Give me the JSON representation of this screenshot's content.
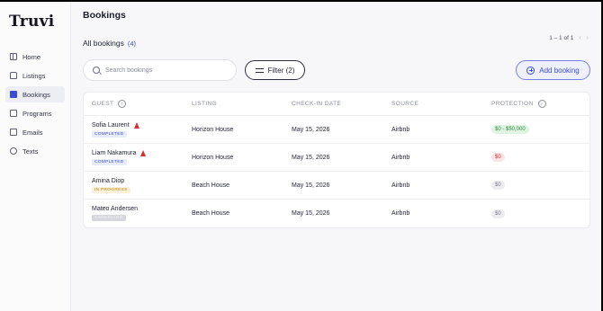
{
  "app": {
    "logo": "Truvi"
  },
  "sidebar": {
    "items": [
      {
        "label": "Home",
        "icon": "home-icon",
        "active": false
      },
      {
        "label": "Listings",
        "icon": "listings-icon",
        "active": false
      },
      {
        "label": "Bookings",
        "icon": "calendar-icon",
        "active": true
      },
      {
        "label": "Programs",
        "icon": "programs-icon",
        "active": false
      },
      {
        "label": "Emails",
        "icon": "mail-icon",
        "active": false
      },
      {
        "label": "Texts",
        "icon": "chat-icon",
        "active": false
      }
    ]
  },
  "header": {
    "title": "Bookings"
  },
  "subheader": {
    "label": "All bookings",
    "count": "(4)"
  },
  "pagination": {
    "range": "1 – 1 of 1",
    "prev": "‹",
    "next": "›"
  },
  "search": {
    "placeholder": "Search bookings",
    "value": ""
  },
  "filter": {
    "label": "Filter (2)"
  },
  "add_booking": {
    "label": "Add booking"
  },
  "table": {
    "columns": [
      "GUEST",
      "LISTING",
      "CHECK-IN DATE",
      "SOURCE",
      "PROTECTION"
    ],
    "info_glyph": "i",
    "rows": [
      {
        "guest": "Sofia Laurent",
        "status": "COMPLETED",
        "listing": "Horizon House",
        "checkin": "May 15, 2026",
        "source": "Airbnb",
        "protection": "$0 - $50,000"
      },
      {
        "guest": "Liam Nakamura",
        "status": "COMPLETED",
        "listing": "Horizon House",
        "checkin": "May 15, 2026",
        "source": "Airbnb",
        "protection": "$0"
      },
      {
        "guest": "Amina Diop",
        "status": "IN PROGRESS",
        "listing": "Beach House",
        "checkin": "May 15, 2026",
        "source": "Airbnb",
        "protection": "$0"
      },
      {
        "guest": "Mateo Andersen",
        "status": "CANCELLED",
        "listing": "Beach House",
        "checkin": "May 15, 2026",
        "source": "Airbnb",
        "protection": "$0"
      }
    ]
  },
  "colors": {
    "accent": "#3b4bd8",
    "warning": "#d3302f",
    "success": "#2f8a3c"
  }
}
